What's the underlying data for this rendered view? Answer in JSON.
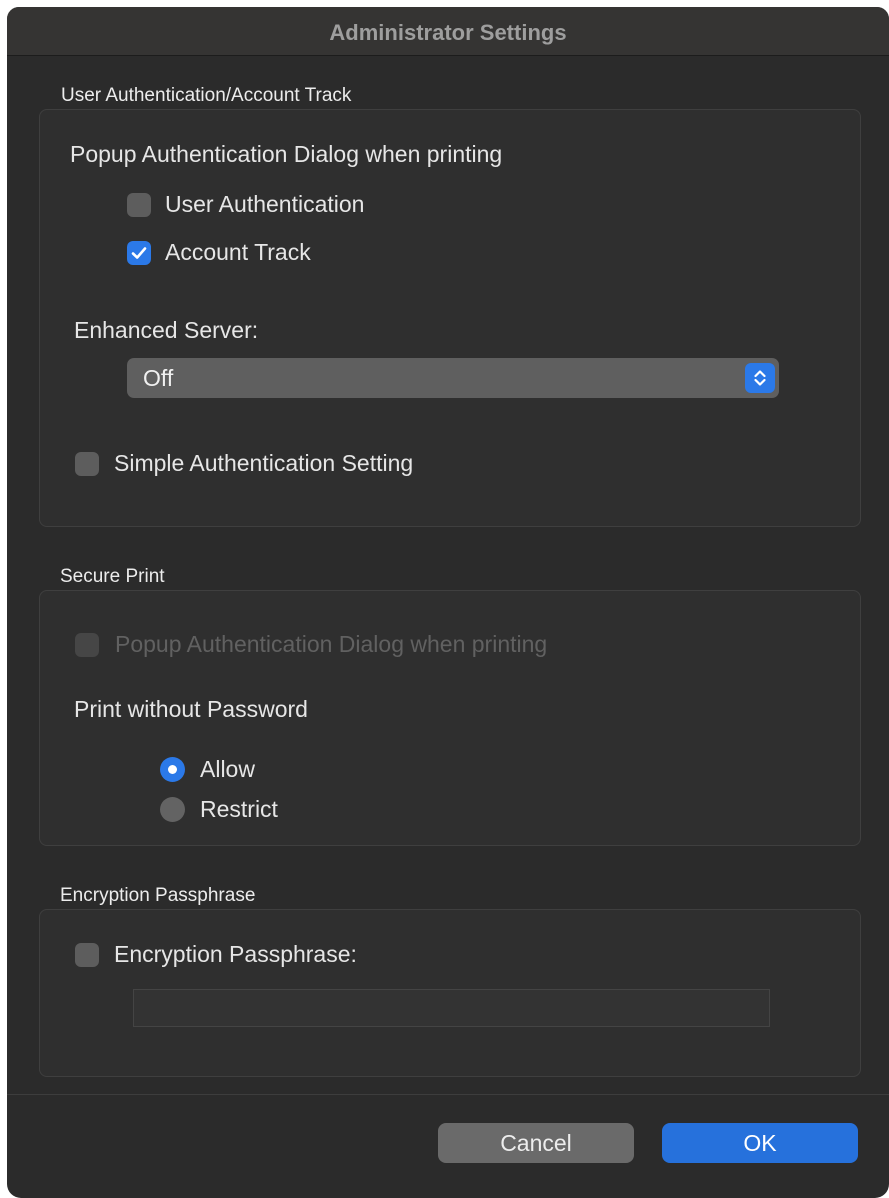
{
  "window": {
    "title": "Administrator Settings"
  },
  "user_auth_section": {
    "label": "User Authentication/Account Track",
    "popup_heading": "Popup Authentication Dialog when printing",
    "user_authentication": {
      "label": "User Authentication",
      "checked": false
    },
    "account_track": {
      "label": "Account Track",
      "checked": true
    },
    "enhanced_server_label": "Enhanced Server:",
    "enhanced_server_value": "Off",
    "simple_auth": {
      "label": "Simple Authentication Setting",
      "checked": false
    }
  },
  "secure_print_section": {
    "label": "Secure Print",
    "popup_auth": {
      "label": "Popup Authentication Dialog when printing",
      "checked": false,
      "disabled": true
    },
    "print_without_password_label": "Print without Password",
    "options": [
      {
        "label": "Allow",
        "selected": true
      },
      {
        "label": "Restrict",
        "selected": false
      }
    ]
  },
  "encryption_section": {
    "label": "Encryption Passphrase",
    "checkbox": {
      "label": "Encryption Passphrase:",
      "checked": false
    },
    "passphrase_value": ""
  },
  "buttons": {
    "cancel": "Cancel",
    "ok": "OK"
  },
  "colors": {
    "accent": "#2b79e8",
    "window_bg": "#2b2b2b",
    "group_bg": "#2f2f2f"
  }
}
